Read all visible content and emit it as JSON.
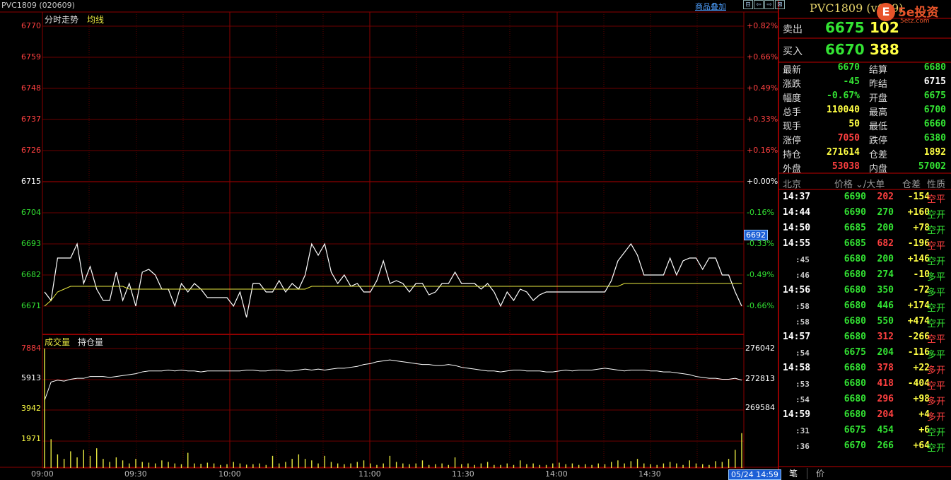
{
  "header": {
    "title": "PVC1809 (020609)",
    "overlay_link": "商品叠加",
    "window_buttons": [
      "⊟",
      "⇦",
      "⇨",
      "⊠"
    ]
  },
  "price_chart": {
    "label": "分时走势",
    "avg_label": "均线",
    "y_ticks": [
      {
        "value": "6770",
        "pct": "+0.82%",
        "color": "#ff4040"
      },
      {
        "value": "6759",
        "pct": "+0.66%",
        "color": "#ff4040"
      },
      {
        "value": "6748",
        "pct": "+0.49%",
        "color": "#ff4040"
      },
      {
        "value": "6737",
        "pct": "+0.33%",
        "color": "#ff4040"
      },
      {
        "value": "6726",
        "pct": "+0.16%",
        "color": "#ff4040"
      },
      {
        "value": "6715",
        "pct": "+0.00%",
        "color": "#ffffff"
      },
      {
        "value": "6704",
        "pct": "-0.16%",
        "color": "#33e333"
      },
      {
        "value": "6693",
        "pct": "-0.33%",
        "color": "#33e333"
      },
      {
        "value": "6682",
        "pct": "-0.49%",
        "color": "#33e333"
      },
      {
        "value": "6671",
        "pct": "-0.66%",
        "color": "#33e333"
      }
    ],
    "current_price": "6692",
    "colors": {
      "price": "#ffffff",
      "avg": "#e8e840",
      "up": "#ff4040",
      "down": "#33e333",
      "grid": "#8b0000"
    }
  },
  "volume_chart": {
    "label_volume": "成交量",
    "label_oi": "持仓量",
    "y_ticks_left": [
      "7884",
      "5913",
      "3942",
      "1971"
    ],
    "y_ticks_right": [
      "276042",
      "272813",
      "269584"
    ]
  },
  "x_axis": {
    "ticks": [
      "09:00",
      "09:30",
      "10:00",
      "11:00",
      "11:30",
      "14:00",
      "14:30"
    ],
    "date_badge": "05/24 14:59"
  },
  "chart_data": {
    "type": "line",
    "price_series": [
      6676,
      6673,
      6688,
      6688,
      6688,
      6693,
      6679,
      6685,
      6677,
      6673,
      6673,
      6683,
      6673,
      6679,
      6671,
      6683,
      6684,
      6682,
      6677,
      6677,
      6671,
      6679,
      6676,
      6679,
      6677,
      6674,
      6674,
      6674,
      6674,
      6671,
      6676,
      6667,
      6679,
      6679,
      6676,
      6676,
      6680,
      6676,
      6679,
      6677,
      6682,
      6693,
      6689,
      6693,
      6683,
      6679,
      6682,
      6678,
      6679,
      6676,
      6676,
      6680,
      6687,
      6679,
      6680,
      6679,
      6676,
      6679,
      6679,
      6675,
      6676,
      6679,
      6679,
      6683,
      6679,
      6679,
      6679,
      6677,
      6679,
      6676,
      6671,
      6676,
      6673,
      6677,
      6676,
      6673,
      6675,
      6676,
      6676,
      6676,
      6676,
      6676,
      6676,
      6676,
      6676,
      6676,
      6676,
      6680,
      6687,
      6690,
      6693,
      6689,
      6682,
      6682,
      6682,
      6682,
      6688,
      6682,
      6687,
      6688,
      6688,
      6684,
      6688,
      6688,
      6682,
      6682,
      6676,
      6671
    ],
    "avg_series": [
      6671,
      6673,
      6676,
      6677,
      6678,
      6678,
      6678,
      6678,
      6678,
      6678,
      6678,
      6678,
      6678,
      6677,
      6677,
      6677,
      6677,
      6677,
      6677,
      6677,
      6677,
      6677,
      6677,
      6677,
      6677,
      6677,
      6677,
      6677,
      6677,
      6677,
      6677,
      6677,
      6677,
      6677,
      6677,
      6677,
      6677,
      6677,
      6677,
      6677,
      6677,
      6678,
      6678,
      6678,
      6678,
      6678,
      6678,
      6678,
      6678,
      6678,
      6678,
      6678,
      6678,
      6678,
      6678,
      6678,
      6678,
      6678,
      6678,
      6678,
      6678,
      6678,
      6678,
      6678,
      6678,
      6678,
      6678,
      6678,
      6678,
      6678,
      6678,
      6678,
      6678,
      6678,
      6678,
      6678,
      6678,
      6678,
      6678,
      6678,
      6678,
      6678,
      6678,
      6678,
      6678,
      6678,
      6678,
      6678,
      6678,
      6679,
      6679,
      6679,
      6679,
      6679,
      6679,
      6679,
      6679,
      6679,
      6679,
      6679,
      6679,
      6679,
      6679,
      6679,
      6679,
      6679,
      6679,
      6679
    ],
    "open_interest_series": [
      270400,
      272400,
      272600,
      272500,
      272700,
      272800,
      272800,
      273000,
      273000,
      273000,
      272900,
      273000,
      273100,
      273200,
      273300,
      273500,
      273600,
      273600,
      273600,
      273700,
      273600,
      273700,
      273600,
      273600,
      273500,
      273600,
      273600,
      273600,
      273600,
      273600,
      273600,
      273700,
      273700,
      273600,
      273600,
      273700,
      273700,
      273600,
      273600,
      273700,
      273800,
      273700,
      273800,
      273700,
      273800,
      273900,
      273900,
      274000,
      274100,
      274300,
      274400,
      274600,
      274700,
      274800,
      274700,
      274600,
      274500,
      274400,
      274300,
      274300,
      274200,
      274200,
      274300,
      274200,
      274000,
      273900,
      273800,
      273700,
      273600,
      273600,
      273500,
      273600,
      273700,
      273700,
      273600,
      273600,
      273600,
      273500,
      273500,
      273600,
      273700,
      273600,
      273700,
      273700,
      273700,
      273800,
      273900,
      273800,
      273700,
      273600,
      273700,
      273700,
      273700,
      273600,
      273600,
      273500,
      273500,
      273400,
      273300,
      273200,
      273000,
      272900,
      272800,
      272800,
      272700,
      272700,
      272800,
      272600
    ],
    "volume_series": [
      7884,
      1900,
      900,
      600,
      1100,
      700,
      1200,
      800,
      1300,
      600,
      400,
      700,
      500,
      300,
      600,
      400,
      350,
      300,
      500,
      400,
      300,
      250,
      1000,
      300,
      280,
      350,
      300,
      200,
      250,
      400,
      300,
      220,
      250,
      300,
      200,
      800,
      300,
      400,
      600,
      900,
      600,
      500,
      300,
      800,
      400,
      300,
      250,
      300,
      400,
      500,
      300,
      200,
      300,
      800,
      400,
      300,
      250,
      300,
      500,
      200,
      250,
      300,
      200,
      700,
      250,
      300,
      200,
      300,
      400,
      200,
      200,
      300,
      200,
      500,
      250,
      300,
      200,
      200,
      300,
      350,
      250,
      300,
      200,
      250,
      200,
      300,
      250,
      400,
      500,
      300,
      450,
      600,
      300,
      250,
      200,
      300,
      400,
      300,
      200,
      500,
      300,
      250,
      200,
      450,
      400,
      600,
      1200,
      2300
    ]
  },
  "quote_panel": {
    "title": "PVC1809 (v609)",
    "logo_glyph": "E",
    "logo_text": "5e投资",
    "logo_sub": "5etz.com",
    "sell_label": "卖出",
    "sell_price": "6675",
    "sell_vol": "102",
    "buy_label": "买入",
    "buy_price": "6670",
    "buy_vol": "388",
    "stats": [
      {
        "l1": "最新",
        "v1": "6670",
        "c1": "#33e333",
        "l2": "结算",
        "v2": "6680",
        "c2": "#33e333"
      },
      {
        "l1": "涨跌",
        "v1": "-45",
        "c1": "#33e333",
        "l2": "昨结",
        "v2": "6715",
        "c2": "#ffffff"
      },
      {
        "l1": "幅度",
        "v1": "-0.67%",
        "c1": "#33e333",
        "l2": "开盘",
        "v2": "6675",
        "c2": "#33e333"
      },
      {
        "l1": "总手",
        "v1": "110040",
        "c1": "#ffff44",
        "l2": "最高",
        "v2": "6700",
        "c2": "#33e333"
      },
      {
        "l1": "现手",
        "v1": "50",
        "c1": "#ffff44",
        "l2": "最低",
        "v2": "6660",
        "c2": "#33e333"
      },
      {
        "l1": "涨停",
        "v1": "7050",
        "c1": "#ff4040",
        "l2": "跌停",
        "v2": "6380",
        "c2": "#33e333"
      },
      {
        "l1": "持仓",
        "v1": "271614",
        "c1": "#ffff44",
        "l2": "仓差",
        "v2": "1892",
        "c2": "#ffff44"
      },
      {
        "l1": "外盘",
        "v1": "53038",
        "c1": "#ff4040",
        "l2": "内盘",
        "v2": "57002",
        "c2": "#33e333"
      }
    ],
    "table_header": {
      "time": "北京",
      "price": "价格",
      "vol": "⌄/大单",
      "oi": "仓差",
      "nature": "性质"
    },
    "trades": [
      {
        "time": "14:37",
        "small": false,
        "price": "6690",
        "vol": "202",
        "vol_color": "#ff4040",
        "oi": "-154",
        "nature": "空平",
        "nat_color": "#ff4040"
      },
      {
        "time": "14:44",
        "small": false,
        "price": "6690",
        "vol": "270",
        "vol_color": "#33e333",
        "oi": "+160",
        "nature": "空开",
        "nat_color": "#33e333"
      },
      {
        "time": "14:50",
        "small": false,
        "price": "6685",
        "vol": "200",
        "vol_color": "#33e333",
        "oi": "+78",
        "nature": "空开",
        "nat_color": "#33e333"
      },
      {
        "time": "14:55",
        "small": false,
        "price": "6685",
        "vol": "682",
        "vol_color": "#ff4040",
        "oi": "-196",
        "nature": "空平",
        "nat_color": "#ff4040"
      },
      {
        "time": ":45",
        "small": true,
        "price": "6680",
        "vol": "200",
        "vol_color": "#33e333",
        "oi": "+146",
        "nature": "空开",
        "nat_color": "#33e333"
      },
      {
        "time": ":46",
        "small": true,
        "price": "6680",
        "vol": "274",
        "vol_color": "#33e333",
        "oi": "-10",
        "nature": "多平",
        "nat_color": "#33e333"
      },
      {
        "time": "14:56",
        "small": false,
        "price": "6680",
        "vol": "350",
        "vol_color": "#33e333",
        "oi": "-72",
        "nature": "多平",
        "nat_color": "#33e333"
      },
      {
        "time": ":58",
        "small": true,
        "price": "6680",
        "vol": "446",
        "vol_color": "#33e333",
        "oi": "+174",
        "nature": "空开",
        "nat_color": "#33e333"
      },
      {
        "time": ":58",
        "small": true,
        "price": "6680",
        "vol": "550",
        "vol_color": "#33e333",
        "oi": "+474",
        "nature": "空开",
        "nat_color": "#33e333"
      },
      {
        "time": "14:57",
        "small": false,
        "price": "6680",
        "vol": "312",
        "vol_color": "#ff4040",
        "oi": "-266",
        "nature": "空平",
        "nat_color": "#ff4040"
      },
      {
        "time": ":54",
        "small": true,
        "price": "6675",
        "vol": "204",
        "vol_color": "#33e333",
        "oi": "-116",
        "nature": "多平",
        "nat_color": "#33e333"
      },
      {
        "time": "14:58",
        "small": false,
        "price": "6680",
        "vol": "378",
        "vol_color": "#ff4040",
        "oi": "+22",
        "nature": "多开",
        "nat_color": "#ff4040"
      },
      {
        "time": ":53",
        "small": true,
        "price": "6680",
        "vol": "418",
        "vol_color": "#ff4040",
        "oi": "-404",
        "nature": "空平",
        "nat_color": "#ff4040"
      },
      {
        "time": ":54",
        "small": true,
        "price": "6680",
        "vol": "296",
        "vol_color": "#ff4040",
        "oi": "+98",
        "nature": "多开",
        "nat_color": "#ff4040"
      },
      {
        "time": "14:59",
        "small": false,
        "price": "6680",
        "vol": "204",
        "vol_color": "#ff4040",
        "oi": "+4",
        "nature": "多开",
        "nat_color": "#ff4040"
      },
      {
        "time": ":31",
        "small": true,
        "price": "6675",
        "vol": "454",
        "vol_color": "#33e333",
        "oi": "+6",
        "nature": "空开",
        "nat_color": "#33e333"
      },
      {
        "time": ":36",
        "small": true,
        "price": "6670",
        "vol": "266",
        "vol_color": "#33e333",
        "oi": "+64",
        "nature": "空开",
        "nat_color": "#33e333"
      }
    ],
    "tabs": [
      "笔",
      "价"
    ]
  }
}
